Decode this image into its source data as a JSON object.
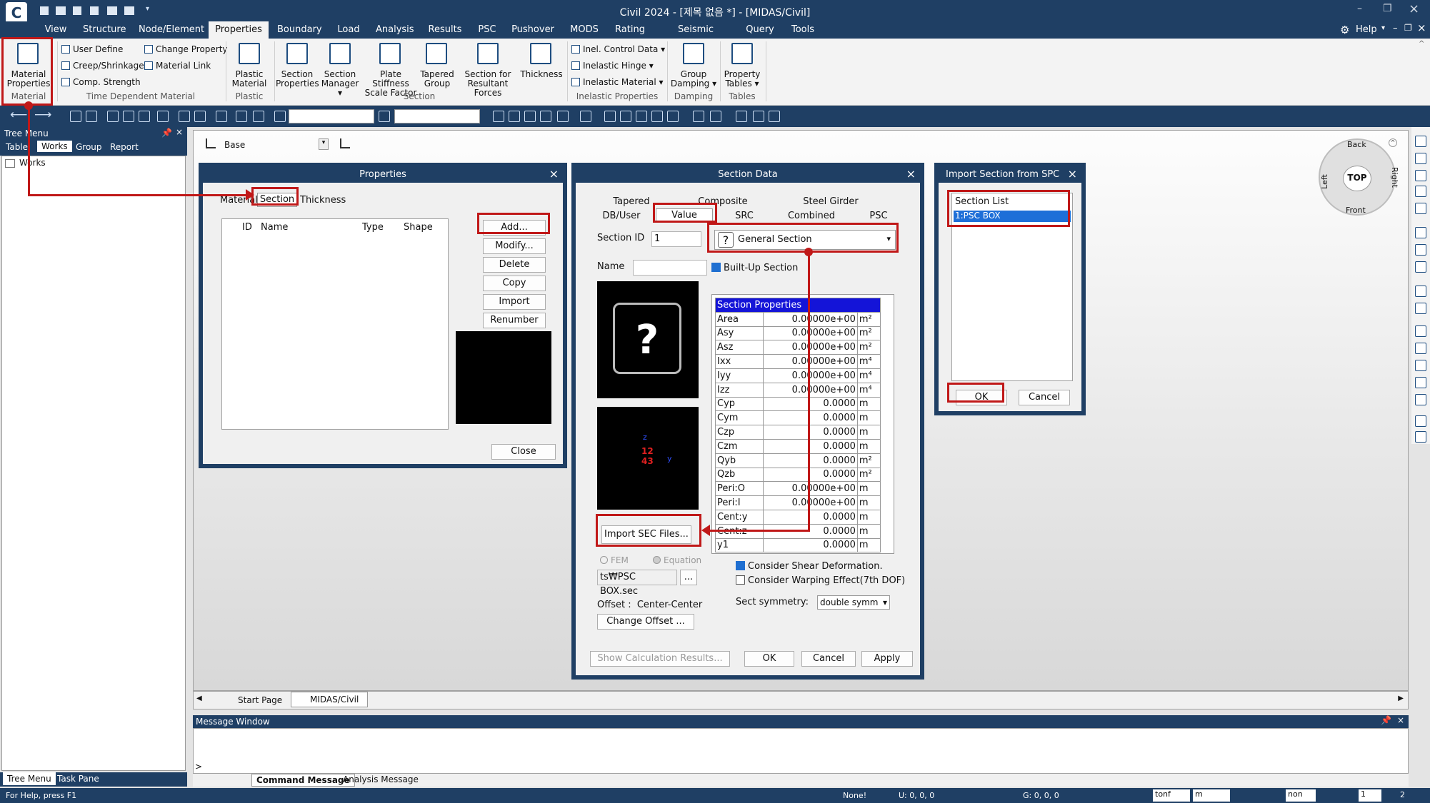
{
  "titlebar": {
    "text": "Civil 2024 - [제목 없음 *] - [MIDAS/Civil]",
    "app_icon": "midas-civil-logo",
    "help": "Help"
  },
  "menu": [
    "View",
    "Structure",
    "Node/Element",
    "Properties",
    "Boundary",
    "Load",
    "Analysis",
    "Results",
    "PSC",
    "Pushover",
    "MODS",
    "Rating",
    "Seismic Perform.",
    "Query",
    "Tools"
  ],
  "ribbon": {
    "material_properties": "Material\nProperties",
    "group_material": "Material",
    "user_define": "User Define",
    "creep_shrinkage": "Creep/Shrinkage",
    "comp_strength": "Comp. Strength",
    "change_property": "Change Property",
    "material_link": "Material Link",
    "group_time": "Time Dependent Material",
    "plastic_material": "Plastic\nMaterial",
    "group_plastic": "Plastic",
    "section_properties": "Section\nProperties",
    "section_manager": "Section\nManager ▾",
    "plate_stiffness": "Plate Stiffness\nScale Factor",
    "tapered_group": "Tapered\nGroup",
    "section_resultant": "Section for\nResultant Forces",
    "thickness": "Thickness",
    "group_section": "Section",
    "inel_control": "Inel. Control Data ▾",
    "inelastic_hinge": "Inelastic Hinge ▾",
    "inelastic_material": "Inelastic Material ▾",
    "group_inelastic": "Inelastic Properties",
    "group_damping_btn": "Group\nDamping ▾",
    "group_damping": "Damping",
    "property_tables": "Property\nTables ▾",
    "group_tables": "Tables"
  },
  "tree": {
    "title": "Tree Menu",
    "tabs": [
      "Table",
      "Works",
      "Group",
      "Report"
    ],
    "root": "Works",
    "bottom_tabs": [
      "Tree Menu",
      "Task Pane"
    ]
  },
  "view": {
    "base": "Base",
    "start_page": "Start Page",
    "midas_tab": "MIDAS/Civil",
    "cube": {
      "back": "Back",
      "front": "Front",
      "left": "Left",
      "right": "Right",
      "top": "TOP"
    }
  },
  "properties": {
    "title": "Properties",
    "tabs": [
      "Material",
      "Section",
      "Thickness"
    ],
    "cols": [
      "ID",
      "Name",
      "Type",
      "Shape"
    ],
    "buttons": [
      "Add...",
      "Modify...",
      "Delete",
      "Copy",
      "Import",
      "Renumber"
    ],
    "close": "Close"
  },
  "section_data": {
    "title": "Section Data",
    "tabs_top": [
      "Tapered",
      "Composite",
      "Steel Girder"
    ],
    "tabs_bottom": [
      "DB/User",
      "Value",
      "SRC",
      "Combined",
      "PSC"
    ],
    "section_id_label": "Section ID",
    "section_id": "1",
    "name_label": "Name",
    "name": "",
    "type": "General Section",
    "builtup": "Built-Up Section",
    "props_header": "Section Properties",
    "rows": [
      [
        "Area",
        "0.00000e+00",
        "m²"
      ],
      [
        "Asy",
        "0.00000e+00",
        "m²"
      ],
      [
        "Asz",
        "0.00000e+00",
        "m²"
      ],
      [
        "Ixx",
        "0.00000e+00",
        "m⁴"
      ],
      [
        "Iyy",
        "0.00000e+00",
        "m⁴"
      ],
      [
        "Izz",
        "0.00000e+00",
        "m⁴"
      ],
      [
        "Cyp",
        "0.0000",
        "m"
      ],
      [
        "Cym",
        "0.0000",
        "m"
      ],
      [
        "Czp",
        "0.0000",
        "m"
      ],
      [
        "Czm",
        "0.0000",
        "m"
      ],
      [
        "Qyb",
        "0.0000",
        "m²"
      ],
      [
        "Qzb",
        "0.0000",
        "m²"
      ],
      [
        "Peri:O",
        "0.00000e+00",
        "m"
      ],
      [
        "Peri:I",
        "0.00000e+00",
        "m"
      ],
      [
        "Cent:y",
        "0.0000",
        "m"
      ],
      [
        "Cent:z",
        "0.0000",
        "m"
      ],
      [
        "y1",
        "0.0000",
        "m"
      ]
    ],
    "import_btn": "Import SEC Files...",
    "fem": "FEM",
    "equation": "Equation",
    "file": "ts₩PSC BOX.sec",
    "browse": "...",
    "offset": "Offset :  Center-Center",
    "change_offset": "Change Offset ...",
    "shear": "Consider Shear Deformation.",
    "warping": "Consider Warping Effect(7th DOF)",
    "symmetry_label": "Sect symmetry:",
    "symmetry": "double symm",
    "show_calc": "Show Calculation Results...",
    "ok": "OK",
    "cancel": "Cancel",
    "apply": "Apply",
    "axis_z": "z",
    "axis_y": "y",
    "quad_top": "12",
    "quad_bottom": "43"
  },
  "import_dlg": {
    "title": "Import Section from SPC",
    "list_header": "Section List",
    "item": "1:PSC BOX",
    "ok": "OK",
    "cancel": "Cancel"
  },
  "message": {
    "title": "Message Window",
    "prompt": ">",
    "tabs": [
      "Command Message",
      "Analysis Message"
    ]
  },
  "status": {
    "help": "For Help, press F1",
    "none": "None!",
    "u": "U: 0, 0, 0",
    "g": "G: 0, 0, 0",
    "force": "tonf",
    "length": "m",
    "non": "non",
    "page": "1",
    "total": "2"
  }
}
